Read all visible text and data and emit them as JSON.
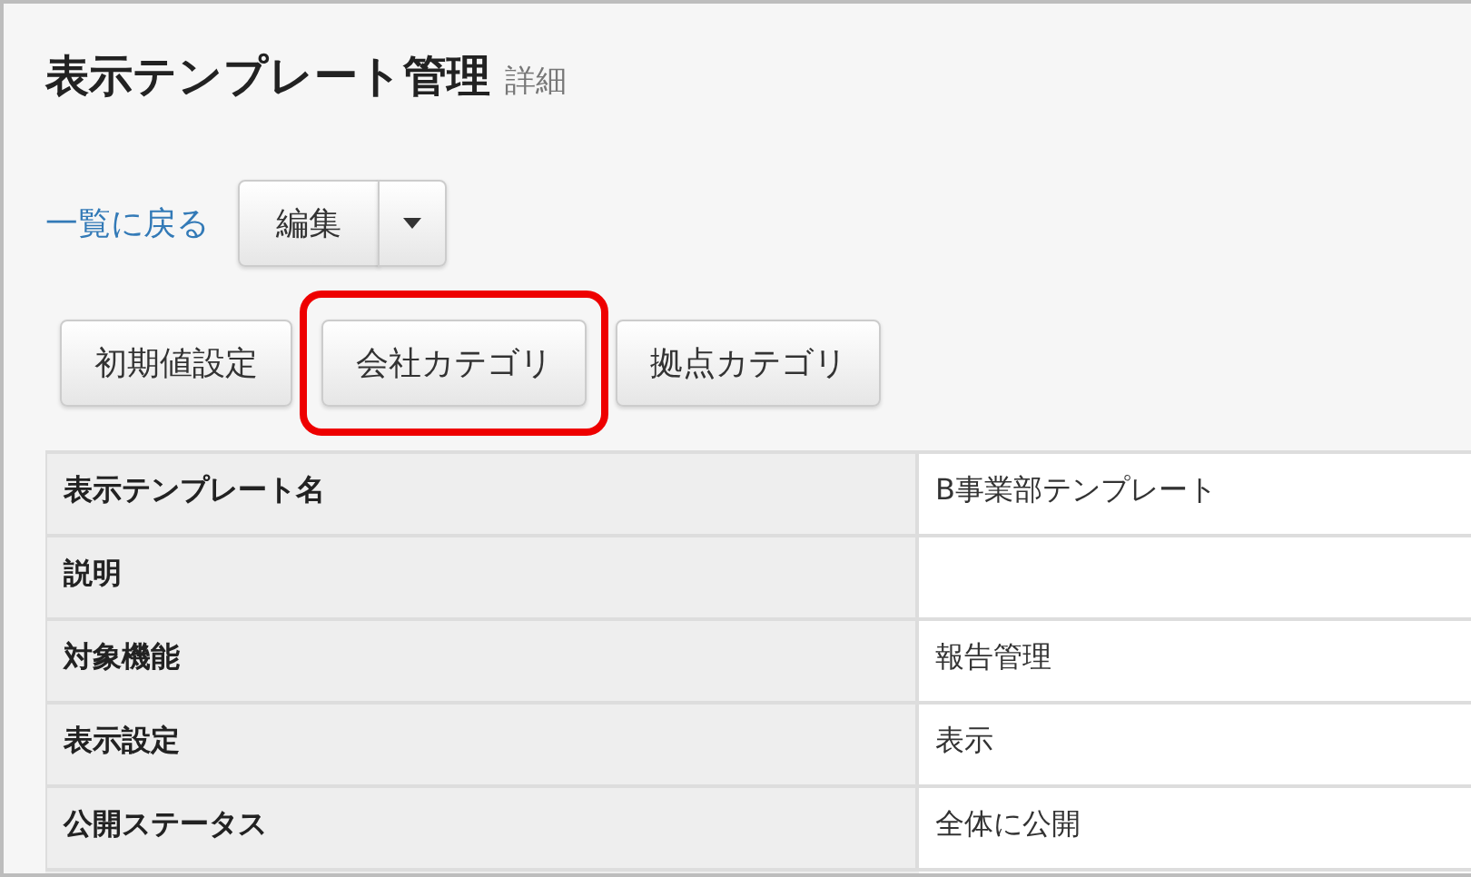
{
  "page": {
    "title": "表示テンプレート管理",
    "subtitle": "詳細"
  },
  "toolbar": {
    "back_link": "一覧に戻る",
    "edit_button": "編集"
  },
  "category_buttons": [
    {
      "label": "初期値設定",
      "highlighted": false
    },
    {
      "label": "会社カテゴリ",
      "highlighted": true
    },
    {
      "label": "拠点カテゴリ",
      "highlighted": false
    }
  ],
  "details": [
    {
      "label": "表示テンプレート名",
      "value": "B事業部テンプレート"
    },
    {
      "label": "説明"
    },
    {
      "label": "対象機能",
      "value": "報告管理"
    },
    {
      "label": "表示設定",
      "value": "表示"
    },
    {
      "label": "公開ステータス",
      "value": "全体に公開"
    }
  ]
}
